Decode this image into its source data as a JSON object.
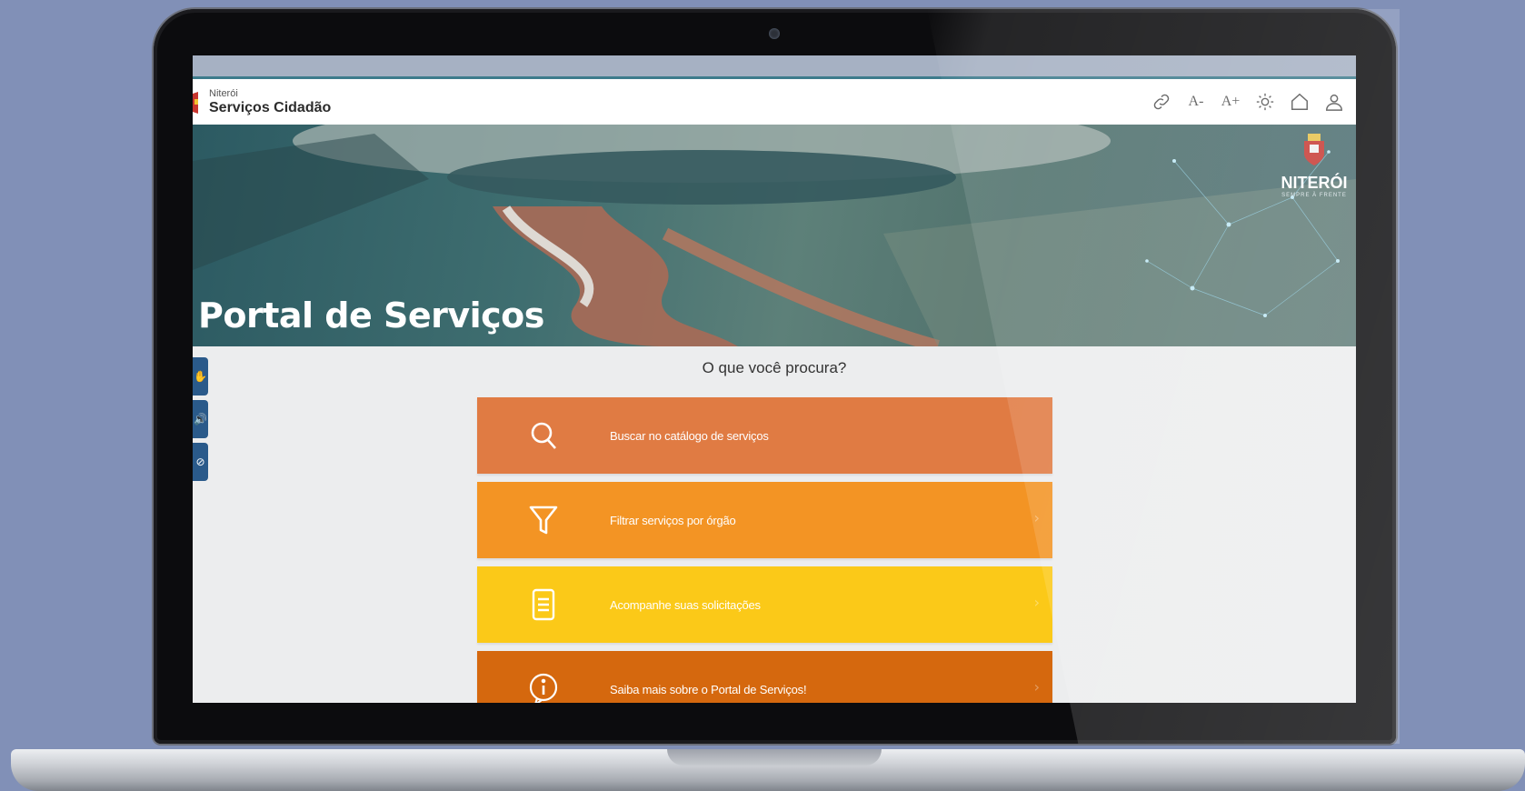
{
  "header": {
    "brand_small": "Niterói",
    "brand_title": "Serviços Cidadão",
    "tools": [
      {
        "icon": "link-icon",
        "label": ""
      },
      {
        "icon": "font-decrease-icon",
        "label": "A-"
      },
      {
        "icon": "font-increase-icon",
        "label": "A+"
      },
      {
        "icon": "contrast-sun-icon",
        "label": ""
      },
      {
        "icon": "home-icon",
        "label": ""
      },
      {
        "icon": "user-icon",
        "label": ""
      }
    ]
  },
  "hero": {
    "title": "Portal de Serviços",
    "logo_text": "NITERÓI",
    "logo_sub": "SEMPRE À FRENTE"
  },
  "main": {
    "question": "O que você procura?",
    "menu": [
      {
        "label": "Buscar no catálogo de serviços",
        "icon": "search-icon",
        "color": "#e07b43",
        "chevron": ""
      },
      {
        "label": "Filtrar serviços por órgão",
        "icon": "filter-icon",
        "color": "#f39424",
        "chevron": "›"
      },
      {
        "label": "Acompanhe suas solicitações",
        "icon": "document-icon",
        "color": "#fbc918",
        "chevron": "›"
      },
      {
        "label": "Saiba mais sobre o Portal de Serviços!",
        "icon": "info-icon",
        "color": "#d5680e",
        "chevron": "›"
      }
    ]
  },
  "colors": {
    "accessibility_tab": "#2a5a8a",
    "background": "#8190b7"
  }
}
